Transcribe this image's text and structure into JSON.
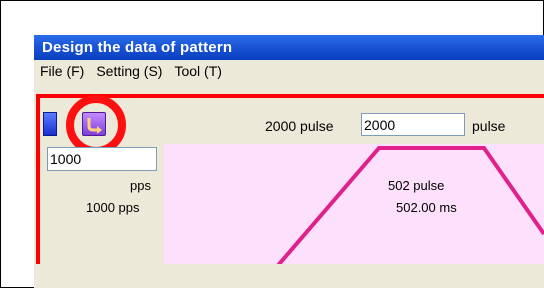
{
  "window": {
    "title": "Design the data of pattern"
  },
  "menu": {
    "items": [
      "File (F)",
      "Setting (S)",
      "Tool (T)"
    ]
  },
  "toolbar": {
    "pulse_label": "2000 pulse",
    "pulse_value": "2000",
    "pulse_unit": "pulse"
  },
  "left_panel": {
    "speed_value": "1000",
    "speed_unit": "pps",
    "speed_display": "1000 pps"
  },
  "graph": {
    "pulse_text": "502 pulse",
    "time_text": "502.00 ms"
  },
  "colors": {
    "highlight": "#ff0000",
    "graph_background": "#fde0fb",
    "graph_line": "#e0208c",
    "titlebar": "#1b55d6"
  },
  "icons": {
    "blue_tool": "blue-tool-icon",
    "purple_tool": "purple-arrow-tool-icon"
  }
}
